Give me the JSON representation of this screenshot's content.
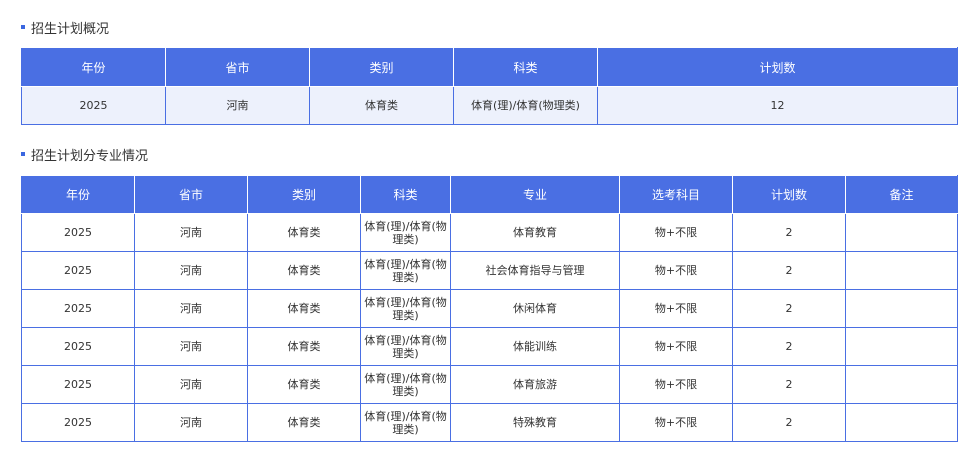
{
  "overview": {
    "title": "招生计划概况",
    "headers": [
      "年份",
      "省市",
      "类别",
      "科类",
      "计划数"
    ],
    "rows": [
      [
        "2025",
        "河南",
        "体育类",
        "体育(理)/体育(物理类)",
        "12"
      ]
    ]
  },
  "majors": {
    "title": "招生计划分专业情况",
    "headers": [
      "年份",
      "省市",
      "类别",
      "科类",
      "专业",
      "选考科目",
      "计划数",
      "备注"
    ],
    "rows": [
      [
        "2025",
        "河南",
        "体育类",
        "体育(理)/体育(物理类)",
        "体育教育",
        "物+不限",
        "2",
        ""
      ],
      [
        "2025",
        "河南",
        "体育类",
        "体育(理)/体育(物理类)",
        "社会体育指导与管理",
        "物+不限",
        "2",
        ""
      ],
      [
        "2025",
        "河南",
        "体育类",
        "体育(理)/体育(物理类)",
        "休闲体育",
        "物+不限",
        "2",
        ""
      ],
      [
        "2025",
        "河南",
        "体育类",
        "体育(理)/体育(物理类)",
        "体能训练",
        "物+不限",
        "2",
        ""
      ],
      [
        "2025",
        "河南",
        "体育类",
        "体育(理)/体育(物理类)",
        "体育旅游",
        "物+不限",
        "2",
        ""
      ],
      [
        "2025",
        "河南",
        "体育类",
        "体育(理)/体育(物理类)",
        "特殊教育",
        "物+不限",
        "2",
        ""
      ]
    ]
  },
  "colors": {
    "header_bg": "#4a6fe3",
    "border": "#4a6fe3",
    "overview_row_bg": "#edf1fc",
    "bullet": "#3a67e0"
  }
}
